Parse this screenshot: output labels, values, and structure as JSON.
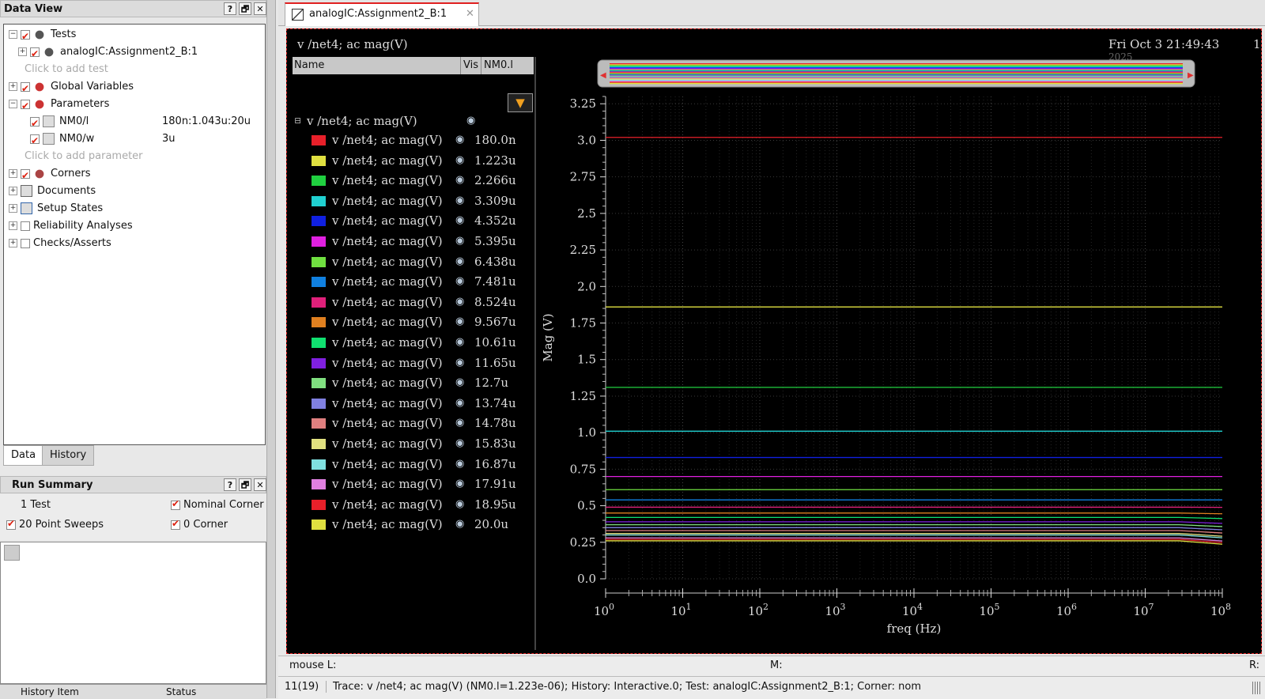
{
  "dataview": {
    "title": "Data View",
    "buttons": [
      "?",
      "🗗",
      "✕"
    ],
    "items": [
      {
        "label": "Tests",
        "exp": "⊟",
        "checked": true,
        "value": ""
      },
      {
        "label": "analogIC:Assignment2_B:1",
        "exp": "⊞",
        "checked": true,
        "value": ""
      },
      {
        "label": "Click to add test",
        "hint": true
      },
      {
        "label": "Global Variables",
        "exp": "⊞",
        "checked": true,
        "value": ""
      },
      {
        "label": "Parameters",
        "exp": "⊟",
        "checked": true,
        "value": ""
      },
      {
        "label": "NM0/l",
        "checked": true,
        "value": "180n:1.043u:20u"
      },
      {
        "label": "NM0/w",
        "checked": true,
        "value": "3u"
      },
      {
        "label": "Click to add parameter",
        "hint": true
      },
      {
        "label": "Corners",
        "exp": "⊞",
        "checked": true,
        "value": ""
      },
      {
        "label": "Documents",
        "exp": "⊞",
        "value": ""
      },
      {
        "label": "Setup States",
        "exp": "⊞",
        "value": ""
      },
      {
        "label": "Reliability Analyses",
        "exp": "⊞",
        "checked": false,
        "value": ""
      },
      {
        "label": "Checks/Asserts",
        "exp": "⊞",
        "checked": false,
        "value": ""
      }
    ],
    "tabs": [
      "Data",
      "History"
    ]
  },
  "runsummary": {
    "title": "Run Summary",
    "test_count": "1 Test",
    "nominal": "Nominal Corner",
    "sweeps": "20 Point Sweeps",
    "corner": "0 Corner"
  },
  "history_headers": [
    "History Item",
    "Status"
  ],
  "doc_tab": {
    "label": "analogIC:Assignment2_B:1",
    "close": "✕"
  },
  "plot": {
    "subwindow_title": "v /net4; ac mag(V)",
    "timestamp": "Fri Oct 3 21:49:43",
    "timestamp_year": "2025",
    "page_no": "1",
    "legend_headers": {
      "name": "Name",
      "vis": "Vis",
      "param": "NM0.l"
    },
    "group_label": "v /net4; ac mag(V)",
    "filter_icon": "filter-icon",
    "eye_icon": "eye-icon"
  },
  "chart_data": {
    "type": "line",
    "xlabel": "freq (Hz)",
    "ylabel": "Mag (V)",
    "xscale": "log",
    "xlim": [
      1,
      100000000
    ],
    "ylim": [
      0,
      3.3
    ],
    "yticks": [
      "0.0",
      "0.25",
      "0.5",
      "0.75",
      "1.0",
      "1.25",
      "1.5",
      "1.75",
      "2.0",
      "2.25",
      "2.5",
      "2.75",
      "3.0",
      "3.25"
    ],
    "xticks_exp": [
      "0",
      "1",
      "2",
      "3",
      "4",
      "5",
      "6",
      "7",
      "8"
    ],
    "xtick_base": "10",
    "grid": true,
    "legend": "left",
    "series": [
      {
        "name": "v /net4; ac mag(V)",
        "param": "180.0n",
        "color": "#e8202a",
        "value": 3.02
      },
      {
        "name": "v /net4; ac mag(V)",
        "param": "1.223u",
        "color": "#e0e040",
        "value": 1.86
      },
      {
        "name": "v /net4; ac mag(V)",
        "param": "2.266u",
        "color": "#20d040",
        "value": 1.31
      },
      {
        "name": "v /net4; ac mag(V)",
        "param": "3.309u",
        "color": "#20d0d0",
        "value": 1.01
      },
      {
        "name": "v /net4; ac mag(V)",
        "param": "4.352u",
        "color": "#1020e0",
        "value": 0.83
      },
      {
        "name": "v /net4; ac mag(V)",
        "param": "5.395u",
        "color": "#e020e0",
        "value": 0.7
      },
      {
        "name": "v /net4; ac mag(V)",
        "param": "6.438u",
        "color": "#70e040",
        "value": 0.61
      },
      {
        "name": "v /net4; ac mag(V)",
        "param": "7.481u",
        "color": "#1080e0",
        "value": 0.54
      },
      {
        "name": "v /net4; ac mag(V)",
        "param": "8.524u",
        "color": "#e0207a",
        "value": 0.49
      },
      {
        "name": "v /net4; ac mag(V)",
        "param": "9.567u",
        "color": "#e08020",
        "value": 0.45
      },
      {
        "name": "v /net4; ac mag(V)",
        "param": "10.61u",
        "color": "#10e070",
        "value": 0.42
      },
      {
        "name": "v /net4; ac mag(V)",
        "param": "11.65u",
        "color": "#8020e0",
        "value": 0.39
      },
      {
        "name": "v /net4; ac mag(V)",
        "param": "12.7u",
        "color": "#80e080",
        "value": 0.37
      },
      {
        "name": "v /net4; ac mag(V)",
        "param": "13.74u",
        "color": "#8080e0",
        "value": 0.35
      },
      {
        "name": "v /net4; ac mag(V)",
        "param": "14.78u",
        "color": "#e08080",
        "value": 0.33
      },
      {
        "name": "v /net4; ac mag(V)",
        "param": "15.83u",
        "color": "#e0e080",
        "value": 0.31
      },
      {
        "name": "v /net4; ac mag(V)",
        "param": "16.87u",
        "color": "#80e0e0",
        "value": 0.3
      },
      {
        "name": "v /net4; ac mag(V)",
        "param": "17.91u",
        "color": "#e080e0",
        "value": 0.28
      },
      {
        "name": "v /net4; ac mag(V)",
        "param": "18.95u",
        "color": "#e8202a",
        "value": 0.27
      },
      {
        "name": "v /net4; ac mag(V)",
        "param": "20.0u",
        "color": "#e0e040",
        "value": 0.26
      }
    ]
  },
  "statusbar": {
    "mouse_l": "mouse L:",
    "mouse_m": "M:",
    "mouse_r": "R:",
    "index": "11(19)",
    "trace": "Trace: v /net4; ac mag(V) (NM0.l=1.223e-06); History: Interactive.0; Test: analogIC:Assignment2_B:1; Corner: nom"
  }
}
